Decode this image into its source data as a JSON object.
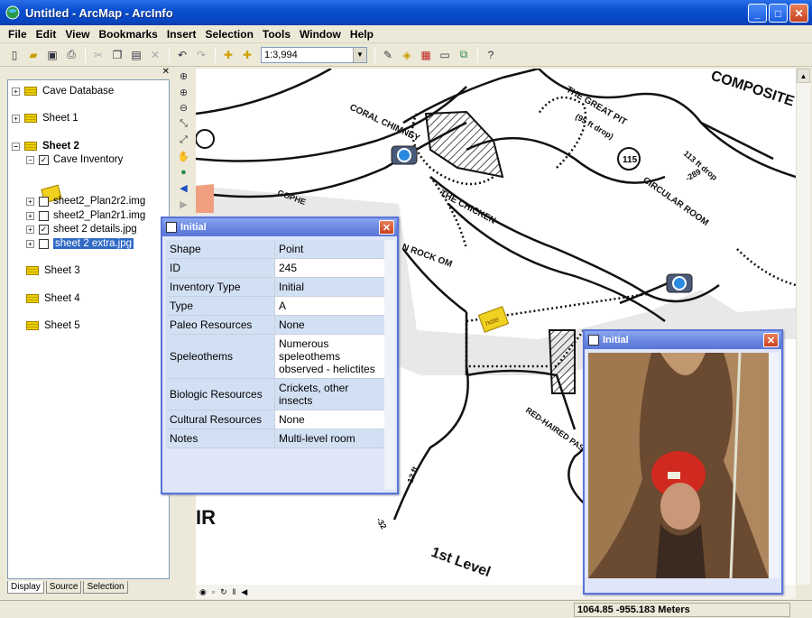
{
  "window": {
    "title": "Untitled - ArcMap - ArcInfo"
  },
  "menu": [
    "File",
    "Edit",
    "View",
    "Bookmarks",
    "Insert",
    "Selection",
    "Tools",
    "Window",
    "Help"
  ],
  "toolbar": {
    "scale": "1:3,994"
  },
  "toc": {
    "groups": [
      {
        "label": "Cave Database",
        "expanded": false
      },
      {
        "label": "Sheet 1",
        "expanded": false
      },
      {
        "label": "Sheet 2",
        "expanded": true
      },
      {
        "label": "Sheet 3",
        "expanded": false
      },
      {
        "label": "Sheet 4",
        "expanded": false
      },
      {
        "label": "Sheet 5",
        "expanded": false
      }
    ],
    "layers": [
      {
        "label": "Cave Inventory",
        "checked": true,
        "expanded": true
      },
      {
        "label": "sheet2_Plan2r2.img",
        "checked": false
      },
      {
        "label": "sheet2_Plan2r1.img",
        "checked": false
      },
      {
        "label": "sheet 2 details.jpg",
        "checked": true
      },
      {
        "label": "sheet 2 extra.jpg",
        "checked": false,
        "selected": true
      }
    ],
    "tabs": [
      "Display",
      "Source",
      "Selection"
    ]
  },
  "identify": {
    "title": "Initial",
    "rows": [
      {
        "key": "Shape",
        "value": "Point"
      },
      {
        "key": "ID",
        "value": "245"
      },
      {
        "key": "Inventory Type",
        "value": "Initial"
      },
      {
        "key": "Type",
        "value": "A"
      },
      {
        "key": "Paleo Resources",
        "value": "None"
      },
      {
        "key": "Speleothems",
        "value": "Numerous speleothems observed - helictites"
      },
      {
        "key": "Biologic Resources",
        "value": "Crickets, other insects"
      },
      {
        "key": "Cultural Resources",
        "value": "None"
      },
      {
        "key": "Notes",
        "value": "Multi-level room"
      }
    ]
  },
  "photo_popup": {
    "title": "Initial"
  },
  "map_labels": {
    "composite": "COMPOSITE",
    "coral_chimney": "CORAL CHIMNEY",
    "great_pit": "THE GREAT PIT",
    "pit_depth": "(95 ft drop)",
    "drop_113": "113 ft drop",
    "circular_room": "CIRCULAR ROOM",
    "chicken": "THE CHICKEN",
    "rock_room": "N ROCK OM",
    "red_haired": "RED-HAIRED PASSA",
    "first_level": "1st Level",
    "ft12": "12 ft",
    "n115": "115",
    "n289": "-289",
    "n32": "-32",
    "gopher": "GOPHE",
    "ir": "IR",
    "note_label": "note"
  },
  "status": {
    "coords": "1064.85  -955.183 Meters"
  }
}
